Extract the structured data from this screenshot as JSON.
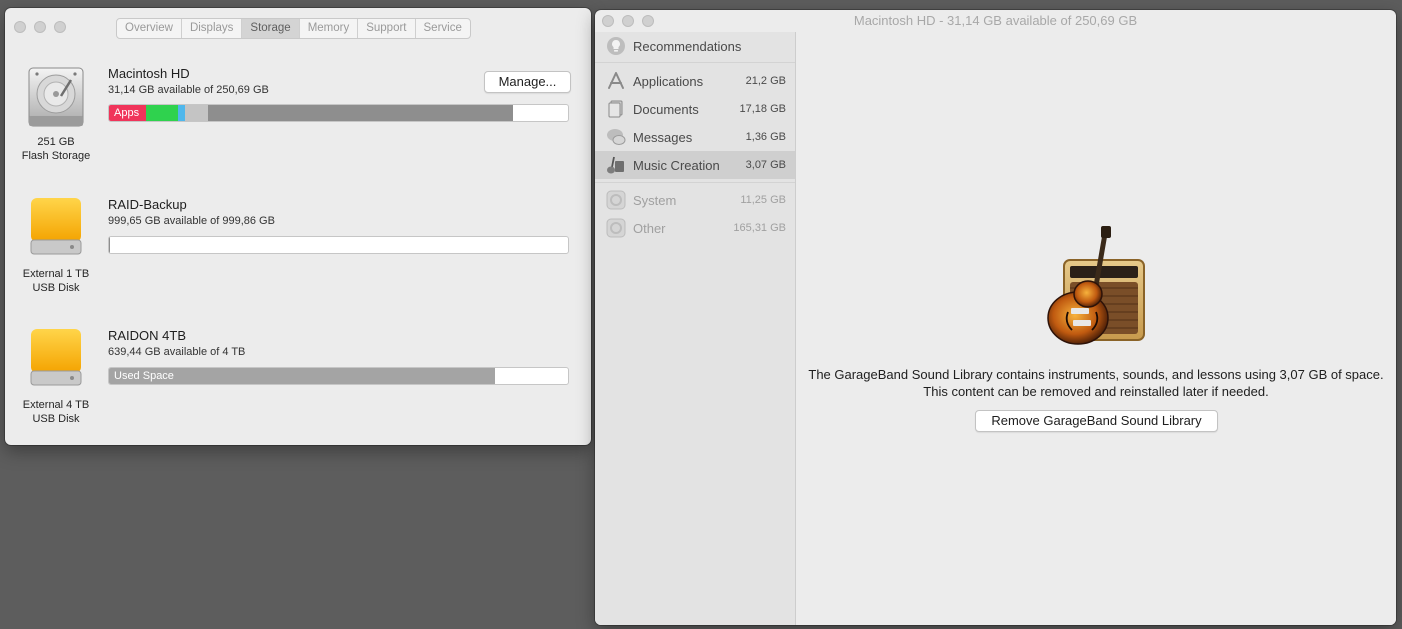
{
  "about_window": {
    "tabs": [
      "Overview",
      "Displays",
      "Storage",
      "Memory",
      "Support",
      "Service"
    ],
    "active_tab": "Storage",
    "manage_label": "Manage...",
    "drives": [
      {
        "name": "Macintosh HD",
        "available": "31,14 GB available of 250,69 GB",
        "caption_line1": "251 GB",
        "caption_line2": "Flash Storage",
        "icon": "internal-disk-icon",
        "bar_label": "Apps",
        "usage_segments": [
          {
            "color": "#f0345a",
            "fraction": 0.08
          },
          {
            "color": "#2fd24e",
            "fraction": 0.07
          },
          {
            "color": "#4fb7ec",
            "fraction": 0.015
          },
          {
            "color": "#c4c4c4",
            "fraction": 0.05
          },
          {
            "color": "#8e8e8e",
            "fraction": 0.665
          }
        ]
      },
      {
        "name": "RAID-Backup",
        "available": "999,65 GB available of 999,86 GB",
        "caption_line1": "External 1 TB",
        "caption_line2": "USB Disk",
        "icon": "external-disk-icon",
        "used_fraction": 0.0002
      },
      {
        "name": "RAIDON 4TB",
        "available": "639,44 GB available of 4 TB",
        "caption_line1": "External 4 TB",
        "caption_line2": "USB Disk",
        "icon": "external-disk-icon",
        "bar_label": "Used Space",
        "used_fraction": 0.84
      }
    ]
  },
  "storage_window": {
    "title": "Macintosh HD - 31,14 GB available of 250,69 GB",
    "sidebar": [
      {
        "label": "Recommendations",
        "size": "",
        "icon": "lightbulb-icon"
      },
      {
        "label": "Applications",
        "size": "21,2 GB",
        "icon": "applications-icon"
      },
      {
        "label": "Documents",
        "size": "17,18 GB",
        "icon": "documents-icon"
      },
      {
        "label": "Messages",
        "size": "1,36 GB",
        "icon": "messages-icon"
      },
      {
        "label": "Music Creation",
        "size": "3,07 GB",
        "icon": "music-creation-icon"
      },
      {
        "label": "System",
        "size": "11,25 GB",
        "icon": "system-icon"
      },
      {
        "label": "Other",
        "size": "165,31 GB",
        "icon": "other-icon"
      }
    ],
    "selected_item": "Music Creation",
    "description": "The GarageBand Sound Library contains instruments, sounds, and lessons using 3,07 GB of space. This content can be removed and reinstalled later if needed.",
    "remove_button": "Remove GarageBand Sound Library",
    "hero_icon": "garageband-icon"
  }
}
